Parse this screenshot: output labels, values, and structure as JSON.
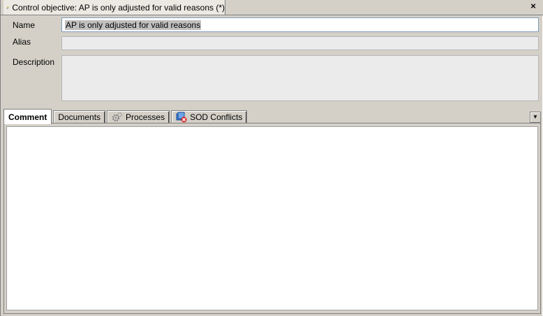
{
  "document_tab": {
    "title": "Control objective: AP is only adjusted for valid reasons (*)",
    "icon": "control-objective-icon",
    "close_label": "×"
  },
  "form": {
    "name_label": "Name",
    "name_value": "AP is only adjusted for valid reasons",
    "alias_label": "Alias",
    "alias_value": "",
    "description_label": "Description",
    "description_value": ""
  },
  "tabs": [
    {
      "label": "Comment",
      "active": true
    },
    {
      "label": "Documents",
      "active": false
    },
    {
      "label": "Processes",
      "icon": "processes-icon",
      "active": false
    },
    {
      "label": "SOD Conflicts",
      "icon": "sod-conflicts-icon",
      "active": false
    }
  ],
  "tab_dropdown": "▼",
  "comment": {
    "value": ""
  }
}
